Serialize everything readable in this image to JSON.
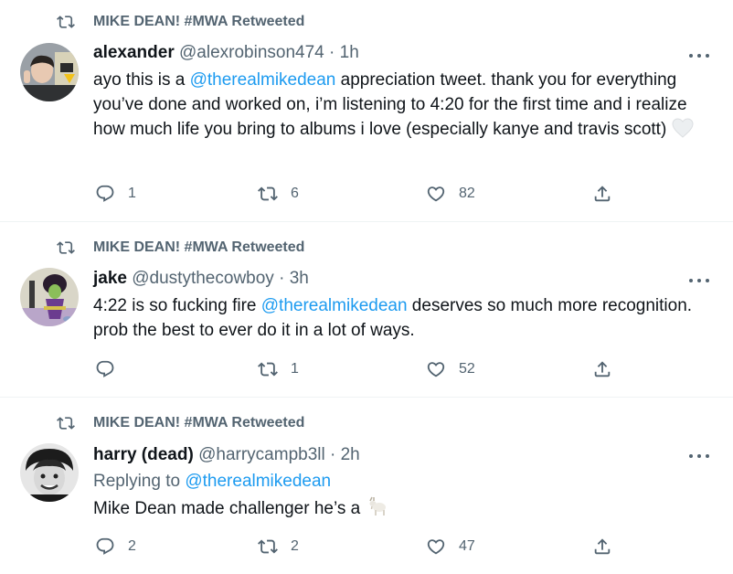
{
  "tweets": [
    {
      "retweeted_by": "MIKE DEAN! #MWA Retweeted",
      "name": "alexander",
      "handle": "@alexrobinson474",
      "dot": "·",
      "time": "1h",
      "text_before": "ayo this is a ",
      "mention": "@therealmikedean",
      "text_after": " appreciation tweet. thank you for everything you’ve done and worked on, i’m listening to 4:20 for the first time and i realize how much life you bring to albums i love (especially kanye and travis scott) ",
      "emoji": "white-heart",
      "replies": "1",
      "retweets": "6",
      "likes": "82"
    },
    {
      "retweeted_by": "MIKE DEAN! #MWA Retweeted",
      "name": "jake",
      "handle": "@dustythecowboy",
      "dot": "·",
      "time": "3h",
      "text_before": "4:22 is so fucking fire ",
      "mention": "@therealmikedean",
      "text_after": " deserves so much more recognition. prob the best to ever do it in a lot of ways.",
      "replies": "",
      "retweets": "1",
      "likes": "52"
    },
    {
      "retweeted_by": "MIKE DEAN! #MWA Retweeted",
      "name": "harry (dead)",
      "handle": "@harrycampb3ll",
      "dot": "·",
      "time": "2h",
      "reply_label": "Replying to ",
      "reply_mention": "@therealmikedean",
      "text_before": "Mike Dean made challenger he’s a ",
      "emoji": "goat",
      "replies": "2",
      "retweets": "2",
      "likes": "47"
    }
  ],
  "colors": {
    "accent": "#1d9bf0",
    "secondary_text": "#536471",
    "primary_text": "#0f1419",
    "divider": "#eff3f4"
  }
}
